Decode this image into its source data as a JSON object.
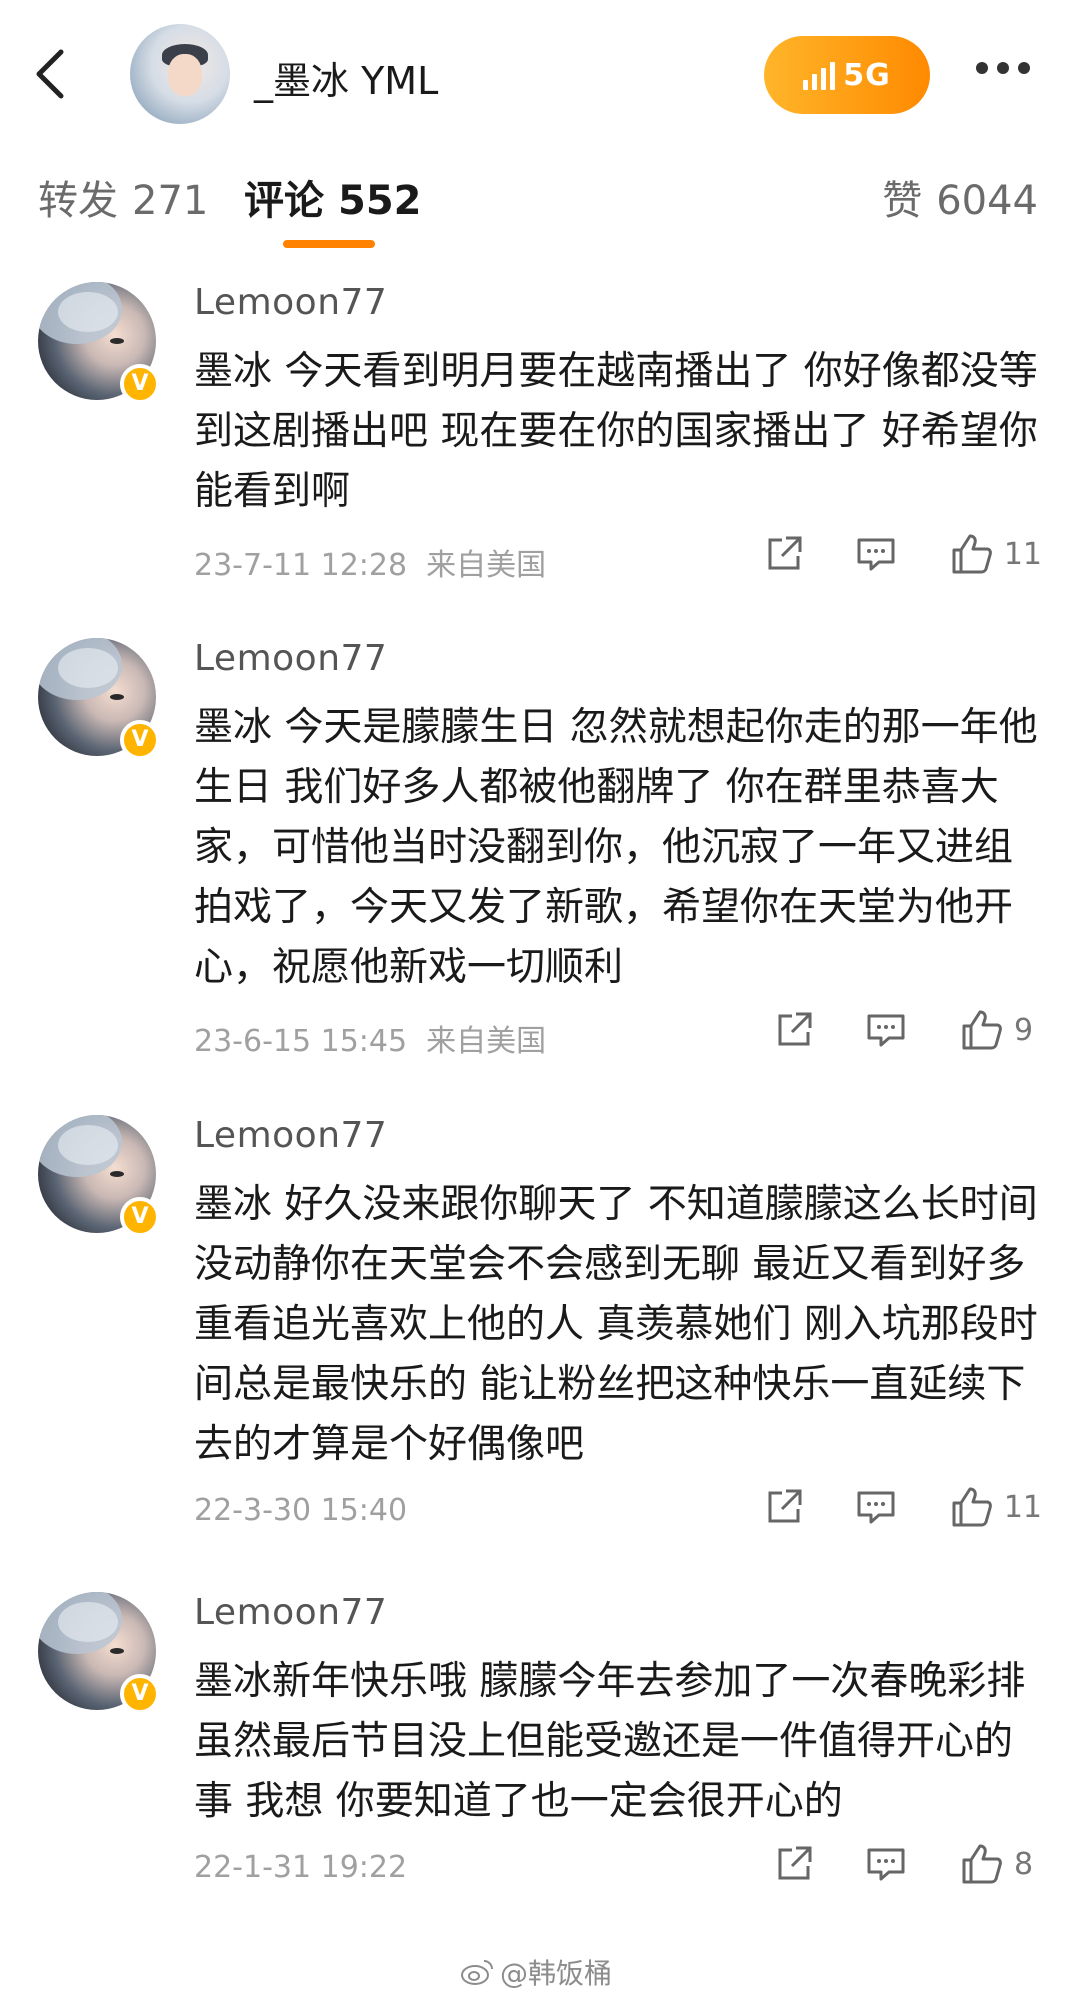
{
  "header": {
    "username": "_墨冰 YML",
    "badge_label": "5G"
  },
  "tabs": [
    {
      "label": "转发",
      "count": "271"
    },
    {
      "label": "评论",
      "count": "552"
    },
    {
      "label": "赞",
      "count": "6044"
    }
  ],
  "comments": [
    {
      "user": "Lemoon77",
      "text": "墨冰 今天看到明月要在越南播出了 你好像都没等到这剧播出吧 现在要在你的国家播出了 好希望你能看到啊",
      "time": "23-7-11 12:28",
      "location": "来自美国",
      "likes": "11"
    },
    {
      "user": "Lemoon77",
      "text": "墨冰 今天是朦朦生日 忽然就想起你走的那一年他生日 我们好多人都被他翻牌了 你在群里恭喜大家，可惜他当时没翻到你，他沉寂了一年又进组拍戏了，今天又发了新歌，希望你在天堂为他开心，祝愿他新戏一切顺利",
      "time": "23-6-15 15:45",
      "location": "来自美国",
      "likes": "9"
    },
    {
      "user": "Lemoon77",
      "text": "墨冰 好久没来跟你聊天了 不知道朦朦这么长时间没动静你在天堂会不会感到无聊 最近又看到好多重看追光喜欢上他的人 真羡慕她们 刚入坑那段时间总是最快乐的 能让粉丝把这种快乐一直延续下去的才算是个好偶像吧",
      "time": "22-3-30 15:40",
      "location": "",
      "likes": "11"
    },
    {
      "user": "Lemoon77",
      "text": "墨冰新年快乐哦 朦朦今年去参加了一次春晚彩排 虽然最后节目没上但能受邀还是一件值得开心的事 我想 你要知道了也一定会很开心的",
      "time": "22-1-31 19:22",
      "location": "",
      "likes": "8"
    }
  ],
  "watermark": "@韩饭桶",
  "colors": {
    "accent": "#ff8200",
    "verified": "#ffb400",
    "meta": "#a0a0a0"
  }
}
